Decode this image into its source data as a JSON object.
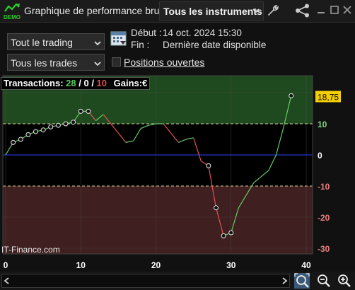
{
  "window": {
    "logo_text": "DEMO",
    "title": "Graphique de performance brute",
    "instrument_selector": "Tous les instruments",
    "icons": [
      "wrench-icon",
      "share-icon",
      "minimize-icon",
      "maximize-icon",
      "close-icon"
    ]
  },
  "filters": {
    "trading_select": "Tout le trading",
    "trades_select": "Tous les trades",
    "start_label": "Début :",
    "start_value": "14 oct. 2024 15:30",
    "end_label": "Fin :",
    "end_value": "Dernière date disponible",
    "open_positions_label": "Positions ouvertes",
    "open_positions_checked": false
  },
  "stats": {
    "transactions_label": "Transactions:",
    "wins": "28",
    "sep1": " / ",
    "neutral": "0",
    "sep2": " / ",
    "losses": "10",
    "gains_label": "Gains:",
    "gains_currency": "€"
  },
  "watermark": "IT-Finance.com",
  "current_value_label": "18,75",
  "colors": {
    "positive_zone": "#1f4a1f",
    "negative_zone": "#3f1f1f",
    "up_line": "#66cc66",
    "down_line": "#e05555",
    "zero_line": "#2233cc",
    "win_count": "#59c959",
    "loss_count": "#e34c4c",
    "value_badge": "#f5d000"
  },
  "chart_data": {
    "type": "line",
    "title": "",
    "xlabel": "",
    "ylabel": "",
    "xlim": [
      0,
      40
    ],
    "ylim": [
      -31,
      26
    ],
    "x_ticks": [
      0,
      10,
      20,
      30,
      40
    ],
    "y_ticks": [
      10,
      0,
      -10,
      -20,
      -30
    ],
    "y_tick_labels": [
      "10",
      "0",
      "-10",
      "-20",
      "-30"
    ],
    "y_zone_bounds": [
      10,
      -10
    ],
    "grid": true,
    "x": [
      0,
      1,
      2,
      3,
      4,
      5,
      6,
      7,
      8,
      9,
      10,
      11,
      12,
      13,
      14,
      15,
      16,
      17,
      18,
      19,
      20,
      21,
      22,
      23,
      24,
      25,
      26,
      27,
      28,
      29,
      30,
      31,
      32,
      33,
      34,
      35,
      36,
      37,
      38
    ],
    "y": [
      0,
      4,
      5,
      6.5,
      7.5,
      8,
      9,
      9.5,
      10,
      10.5,
      14,
      14,
      11,
      13,
      10,
      7,
      4,
      4.5,
      8.5,
      9.5,
      10,
      10,
      7,
      4,
      5,
      5.5,
      -2,
      -3.5,
      -17,
      -26,
      -25,
      -17,
      -13,
      -9,
      -7,
      -5,
      0,
      9,
      19
    ],
    "markers_at": [
      1,
      2,
      3,
      4,
      5,
      6,
      7,
      8,
      9,
      10,
      11,
      27,
      28,
      29,
      30,
      38
    ],
    "current_value": 18.75
  }
}
